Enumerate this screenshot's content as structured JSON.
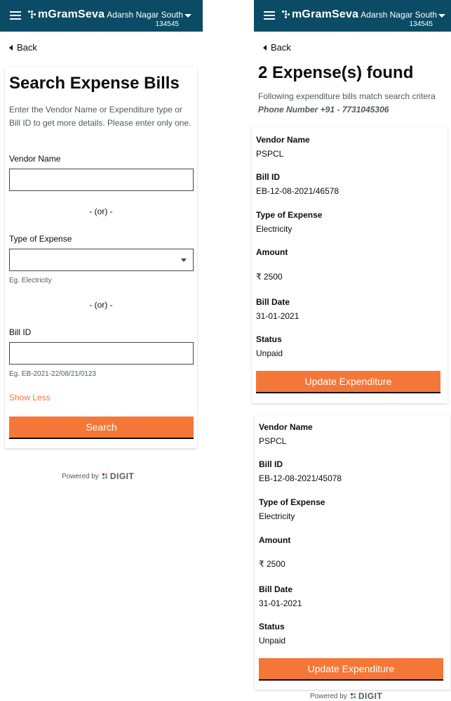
{
  "header": {
    "app_name": "mGramSeva",
    "tenant_name": "Adarsh Nagar South",
    "tenant_code": "134545"
  },
  "nav": {
    "back_label": "Back"
  },
  "search": {
    "title": "Search Expense Bills",
    "description": "Enter the Vendor Name or Expenditure type or Bill ID to get more details. Please enter only one.",
    "vendor_label": "Vendor Name",
    "vendor_value": "",
    "or_label": "- (or) -",
    "type_label": "Type of Expense",
    "type_value": "",
    "type_hint": "Eg. Electricity",
    "billid_label": "Bill ID",
    "billid_value": "",
    "billid_hint": "Eg. EB-2021-22/08/21/0123",
    "show_less": "Show Less",
    "search_button": "Search"
  },
  "results": {
    "title": "2 Expense(s) found",
    "description_prefix": "Following expenditure bills match search critera",
    "description_query": "Phone Number +91 - 7731045306",
    "field_labels": {
      "vendor": "Vendor Name",
      "bill_id": "Bill ID",
      "type": "Type of Expense",
      "amount": "Amount",
      "bill_date": "Bill Date",
      "status": "Status"
    },
    "update_button": "Update Expenditure",
    "items": [
      {
        "vendor": "PSPCL",
        "bill_id": "EB-12-08-2021/46578",
        "type": "Electricity",
        "amount": "₹ 2500",
        "bill_date": "31-01-2021",
        "status": "Unpaid"
      },
      {
        "vendor": "PSPCL",
        "bill_id": "EB-12-08-2021/45078",
        "type": "Electricity",
        "amount": "₹ 2500",
        "bill_date": "31-01-2021",
        "status": "Unpaid"
      }
    ]
  },
  "footer": {
    "powered_by": "Powered by",
    "brand": "DIGIT"
  },
  "colors": {
    "header_bg": "#0b4b66",
    "accent": "#f47738"
  }
}
